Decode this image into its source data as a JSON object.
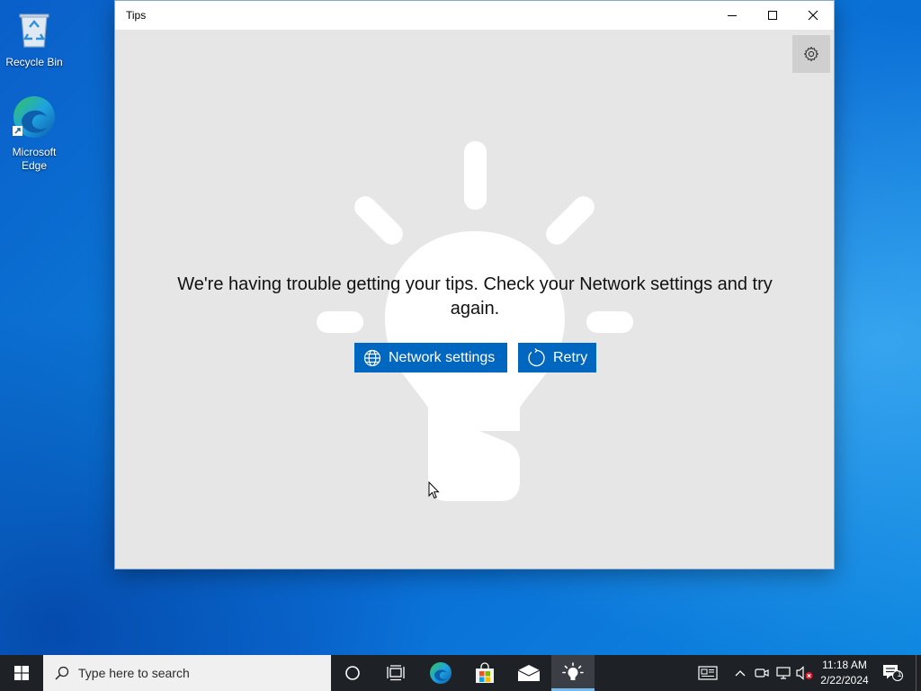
{
  "desktop": {
    "icons": [
      {
        "label": "Recycle Bin",
        "icon": "recycle-bin-icon"
      },
      {
        "label": "Microsoft Edge",
        "icon": "edge-icon"
      }
    ]
  },
  "window": {
    "title": "Tips",
    "controls": [
      "minimize-icon",
      "maximize-icon",
      "close-icon"
    ],
    "settings_icon": "gear-icon",
    "message": "We're having trouble getting your tips. Check your Network settings and try again.",
    "buttons": {
      "network_settings": "Network settings",
      "retry": "Retry"
    },
    "accent": "#0067c0"
  },
  "taskbar": {
    "search_placeholder": "Type here to search",
    "pinned": [
      "cortana-icon",
      "task-view-icon",
      "edge-icon",
      "store-icon",
      "mail-icon",
      "tips-icon"
    ],
    "active_app": "Tips",
    "tray_icons": [
      "news-icon",
      "chevron-up-icon",
      "meet-now-icon",
      "network-icon",
      "volume-muted-icon"
    ],
    "time": "11:18 AM",
    "date": "2/22/2024",
    "notification_count": "1"
  }
}
